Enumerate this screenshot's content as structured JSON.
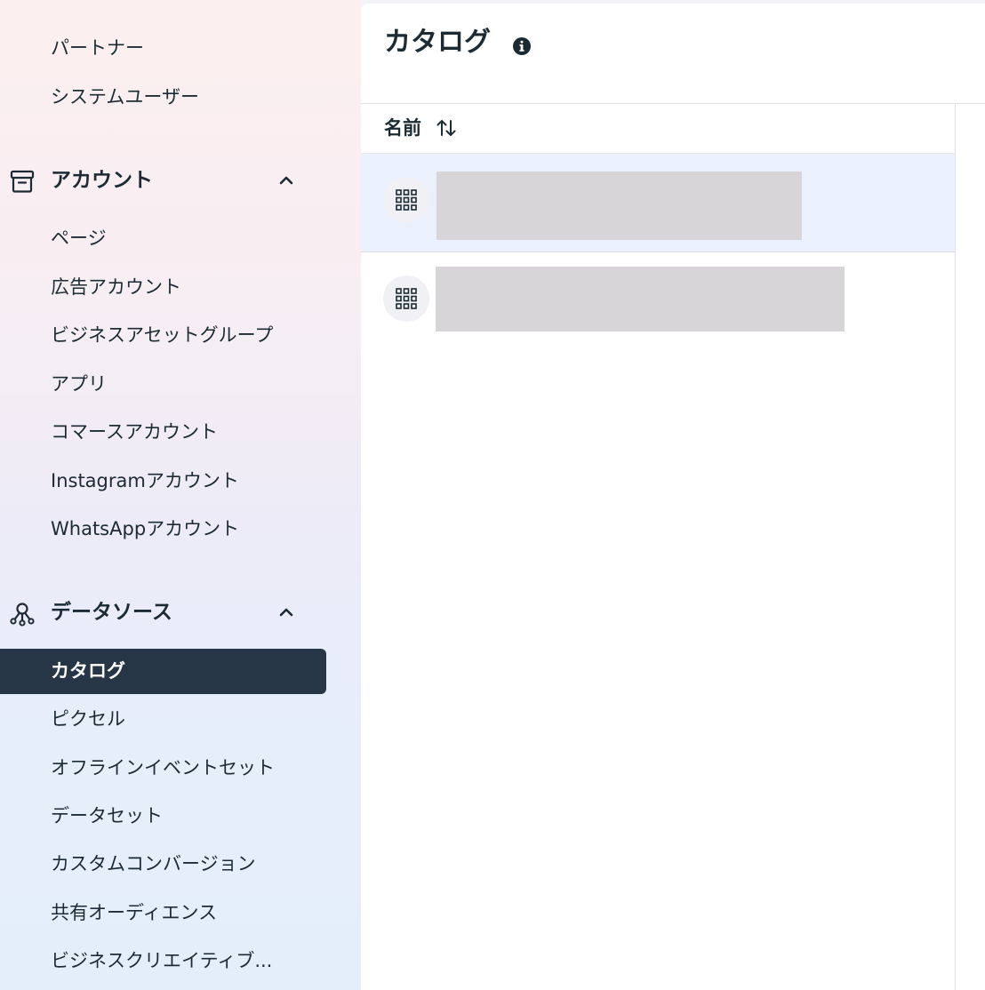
{
  "sidebar": {
    "top_items": [
      "パートナー",
      "システムユーザー"
    ],
    "accounts": {
      "title": "アカウント",
      "items": [
        "ページ",
        "広告アカウント",
        "ビジネスアセットグループ",
        "アプリ",
        "コマースアカウント",
        "Instagramアカウント",
        "WhatsAppアカウント"
      ]
    },
    "data_sources": {
      "title": "データソース",
      "active_item": "カタログ",
      "items": [
        "ピクセル",
        "オフラインイベントセット",
        "データセット",
        "カスタムコンバージョン",
        "共有オーディエンス",
        "ビジネスクリエイティブ..."
      ]
    }
  },
  "main": {
    "title": "カタログ",
    "column_header": "名前"
  },
  "icons": {
    "accounts_section": "archive-box-icon",
    "data_sources_section": "nodes-network-icon",
    "collapse": "chevron-up-icon",
    "info": "info-icon",
    "sort": "sort-arrows-icon",
    "catalog_row": "grid-icon"
  },
  "colors": {
    "active_background": "#263646",
    "selected_row": "#ebf0fd",
    "placeholder": "#d7d5d8"
  }
}
